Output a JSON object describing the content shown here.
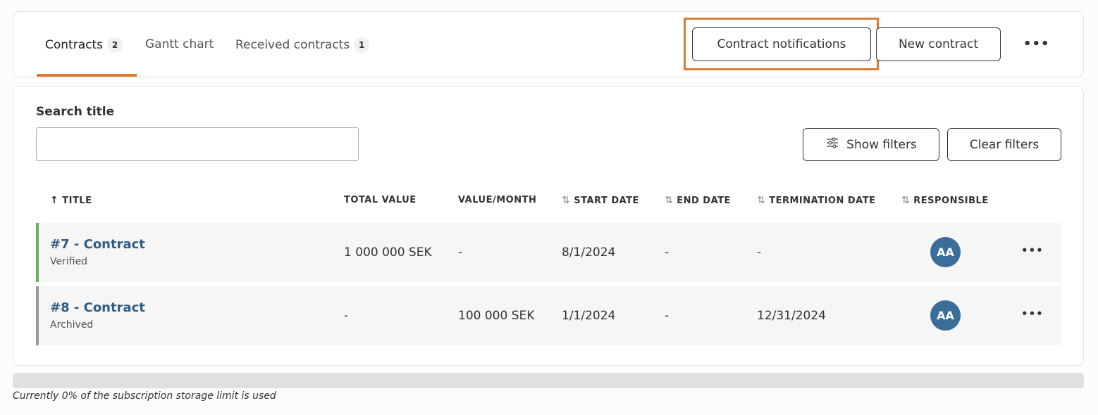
{
  "tabs": [
    {
      "label": "Contracts",
      "count": "2"
    },
    {
      "label": "Gantt chart"
    },
    {
      "label": "Received contracts",
      "count": "1"
    }
  ],
  "actions": {
    "contract_notifications": "Contract notifications",
    "new_contract": "New contract",
    "more": "•••"
  },
  "search": {
    "label": "Search title",
    "value": "",
    "placeholder": ""
  },
  "filters": {
    "show_label": "Show filters",
    "clear_label": "Clear filters"
  },
  "table": {
    "columns": {
      "title": "TITLE",
      "total_value": "TOTAL VALUE",
      "value_month": "VALUE/MONTH",
      "start_date": "START DATE",
      "end_date": "END DATE",
      "termination_date": "TERMINATION DATE",
      "responsible": "RESPONSIBLE"
    },
    "rows": [
      {
        "title": "#7 - Contract",
        "status": "Verified",
        "total_value": "1 000 000 SEK",
        "value_month": "-",
        "start_date": "8/1/2024",
        "end_date": "-",
        "termination_date": "-",
        "responsible": "AA",
        "more": "•••"
      },
      {
        "title": "#8 - Contract",
        "status": "Archived",
        "total_value": "-",
        "value_month": "100 000 SEK",
        "start_date": "1/1/2024",
        "end_date": "-",
        "termination_date": "12/31/2024",
        "responsible": "AA",
        "more": "•••"
      }
    ]
  },
  "storage": {
    "percent_used": 0,
    "text": "Currently 0% of the subscription storage limit is used"
  },
  "colors": {
    "accent": "#e07a2f",
    "link": "#2f5d83",
    "verified": "#6aab5f",
    "archived": "#9a9a9a",
    "avatar": "#3a6d98"
  },
  "icons": {
    "sort_ascending": "arrow-up-icon",
    "sortable": "sort-arrows-icon",
    "filters": "sliders-icon"
  }
}
